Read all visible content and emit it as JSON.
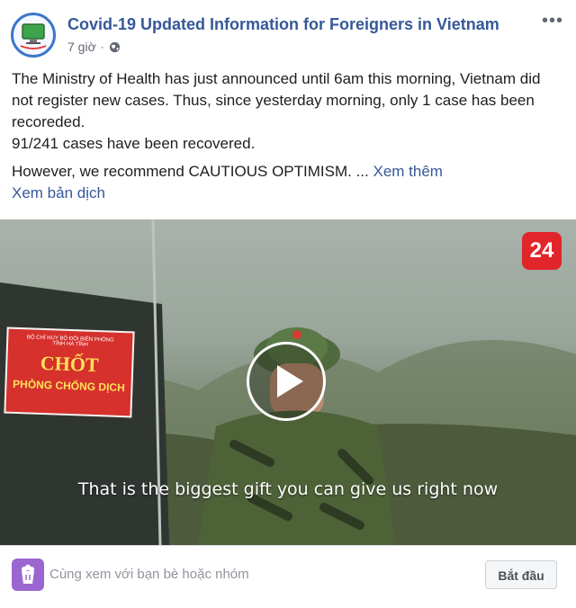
{
  "post": {
    "page_name": "Covid-19 Updated Information for Foreigners in Vietnam",
    "time": "7 giờ",
    "separator": "·",
    "privacy_icon": "globe-icon",
    "more_label": "•••",
    "body": {
      "paragraph_1": "The Ministry of Health has just announced until 6am this morning, Vietnam did not register new cases. Thus, since yesterday morning, only 1 case has been recoreded.",
      "paragraph_2": "91/241 cases have been recovered.",
      "paragraph_3": "However, we recommend CAUTIOUS OPTIMISM. ...",
      "see_more": "Xem thêm",
      "see_translation": "Xem bản dịch"
    }
  },
  "video": {
    "sign_small_text": "BỘ CHỈ HUY BỘ ĐỘI BIÊN PHÒNG",
    "sign_small_text_2": "TỈNH HÀ TĨNH",
    "sign_main": "CHỐT",
    "sign_sub": "PHÒNG CHỐNG DỊCH",
    "channel_logo": "24",
    "caption": "That is the biggest gift you can give us right now"
  },
  "footer": {
    "watch_text": "Cùng xem với bạn bè hoặc nhóm",
    "start_button": "Bắt đầu"
  },
  "colors": {
    "link": "#365899",
    "logo_red": "#e1252a",
    "watch_purple": "#9c66d1"
  }
}
